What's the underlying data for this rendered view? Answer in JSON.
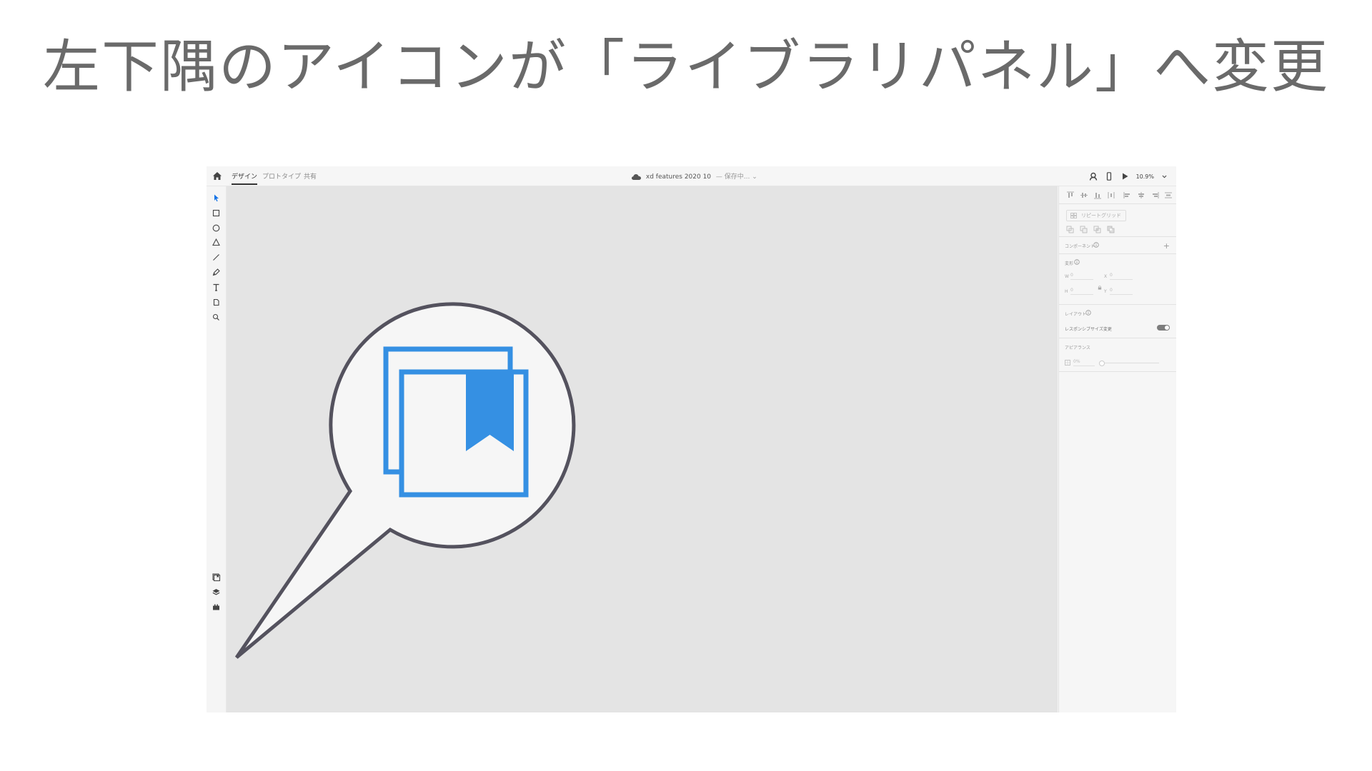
{
  "slide": {
    "title": "左下隅のアイコンが「ライブラリパネル」へ変更"
  },
  "topbar": {
    "tabs": [
      {
        "label": "デザイン",
        "active": true
      },
      {
        "label": "プロトタイプ",
        "active": false
      },
      {
        "label": "共有",
        "active": false
      }
    ],
    "document_title": "xd features 2020 10",
    "save_status": "— 保存中... ⌄",
    "zoom": "10.9%"
  },
  "inspector": {
    "repeat_grid_label": "リピートグリッド",
    "components_label": "コンポーネント",
    "components_add": "+",
    "transform_label": "変形",
    "w_label": "W",
    "w_value": "0",
    "h_label": "H",
    "h_value": "0",
    "x_label": "X",
    "x_value": "0",
    "y_label": "Y",
    "y_value": "0",
    "layout_label": "レイアウト",
    "responsive_label": "レスポンシブサイズ変更",
    "appearance_label": "アピアランス",
    "opacity_value": "0%"
  },
  "colors": {
    "accent": "#3590e3",
    "callout_stroke": "#54525e",
    "callout_fill": "#f6f6f6",
    "title_text": "#6a6a6a",
    "canvas": "#e4e4e4"
  }
}
